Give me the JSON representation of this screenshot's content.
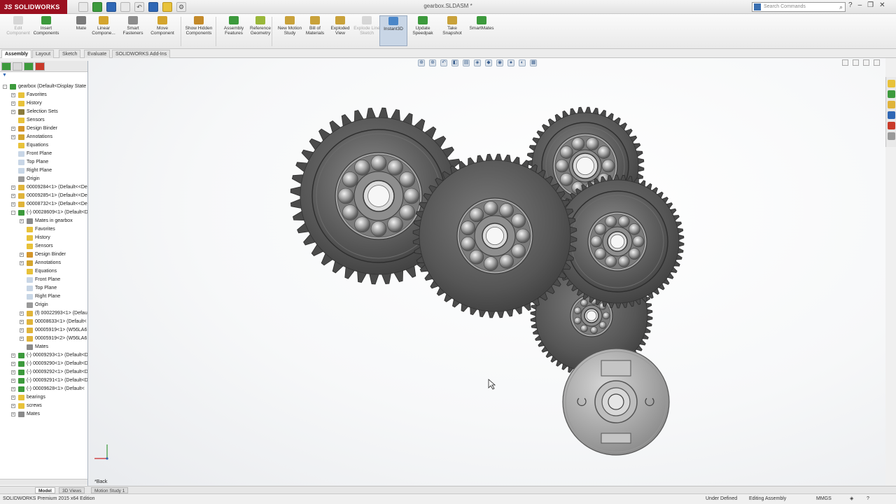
{
  "app": {
    "brand": "SOLIDWORKS",
    "brand_prefix": "3S",
    "document_title": "gearbox.SLDASM *",
    "search_placeholder": "Search Commands"
  },
  "command_manager": {
    "commands": [
      {
        "label": "Edit Component",
        "icon": "edit-component-icon",
        "color": "#9a9a9a",
        "disabled": true
      },
      {
        "label": "Insert Components",
        "icon": "insert-components-icon",
        "color": "#3c9a3c"
      },
      {
        "label": "Mate",
        "icon": "mate-icon",
        "color": "#7a7a7a"
      },
      {
        "label": "Linear Compone...",
        "icon": "linear-pattern-icon",
        "color": "#d4a52e"
      },
      {
        "label": "Smart Fasteners",
        "icon": "smart-fasteners-icon",
        "color": "#8c8c8c"
      },
      {
        "label": "Move Component",
        "icon": "move-component-icon",
        "color": "#d4a52e"
      },
      {
        "label": "Show Hidden Components",
        "icon": "show-hidden-icon",
        "color": "#c48a2a"
      },
      {
        "label": "Assembly Features",
        "icon": "assembly-features-icon",
        "color": "#3c9a3c"
      },
      {
        "label": "Reference Geometry",
        "icon": "reference-geometry-icon",
        "color": "#9ab83a"
      },
      {
        "label": "New Motion Study",
        "icon": "motion-study-icon",
        "color": "#c9a23a"
      },
      {
        "label": "Bill of Materials",
        "icon": "bom-icon",
        "color": "#c9a23a"
      },
      {
        "label": "Exploded View",
        "icon": "exploded-view-icon",
        "color": "#c9a23a"
      },
      {
        "label": "Explode Line Sketch",
        "icon": "explode-line-icon",
        "color": "#9a9a9a",
        "disabled": true
      },
      {
        "label": "Instant3D",
        "icon": "instant3d-icon",
        "color": "#4a86c8",
        "active": true
      },
      {
        "label": "Update Speedpak",
        "icon": "speedpak-icon",
        "color": "#3c9a3c"
      },
      {
        "label": "Take Snapshot",
        "icon": "snapshot-icon",
        "color": "#c9a23a"
      },
      {
        "label": "SmartMates",
        "icon": "smartmates-icon",
        "color": "#3c9a3c"
      }
    ]
  },
  "tabs": [
    "Assembly",
    "Layout",
    "Sketch",
    "Evaluate",
    "SOLIDWORKS Add-Ins"
  ],
  "active_tab": "Assembly",
  "feature_tree": {
    "filter_icon": "filter-icon",
    "items": [
      {
        "label": "gearbox  (Default<Display State",
        "indent": 0,
        "icon": "assembly",
        "toggle": "-"
      },
      {
        "label": "Favorites",
        "indent": 1,
        "icon": "folder",
        "toggle": "+"
      },
      {
        "label": "History",
        "indent": 1,
        "icon": "folder",
        "toggle": "+"
      },
      {
        "label": "Selection Sets",
        "indent": 1,
        "icon": "folder-dark",
        "toggle": "+"
      },
      {
        "label": "Sensors",
        "indent": 1,
        "icon": "folder",
        "toggle": ""
      },
      {
        "label": "Design Binder",
        "indent": 1,
        "icon": "binder",
        "toggle": "+"
      },
      {
        "label": "Annotations",
        "indent": 1,
        "icon": "annotation",
        "toggle": "+"
      },
      {
        "label": "Equations",
        "indent": 1,
        "icon": "folder",
        "toggle": ""
      },
      {
        "label": "Front Plane",
        "indent": 1,
        "icon": "plane",
        "toggle": ""
      },
      {
        "label": "Top Plane",
        "indent": 1,
        "icon": "plane",
        "toggle": ""
      },
      {
        "label": "Right Plane",
        "indent": 1,
        "icon": "plane",
        "toggle": ""
      },
      {
        "label": "Origin",
        "indent": 1,
        "icon": "origin",
        "toggle": ""
      },
      {
        "label": "00009284<1> (Default<<De",
        "indent": 1,
        "icon": "part",
        "toggle": "+"
      },
      {
        "label": "00009285<1> (Default<<De",
        "indent": 1,
        "icon": "part",
        "toggle": "+"
      },
      {
        "label": "00008732<1> (Default<<De",
        "indent": 1,
        "icon": "part",
        "toggle": "+"
      },
      {
        "label": "(-) 00028609<1> (Default<D",
        "indent": 1,
        "icon": "subassembly",
        "toggle": "-"
      },
      {
        "label": "Mates in gearbox",
        "indent": 2,
        "icon": "mates",
        "toggle": "+"
      },
      {
        "label": "Favorites",
        "indent": 2,
        "icon": "folder",
        "toggle": ""
      },
      {
        "label": "History",
        "indent": 2,
        "icon": "folder",
        "toggle": ""
      },
      {
        "label": "Sensors",
        "indent": 2,
        "icon": "folder",
        "toggle": ""
      },
      {
        "label": "Design Binder",
        "indent": 2,
        "icon": "binder",
        "toggle": "+"
      },
      {
        "label": "Annotations",
        "indent": 2,
        "icon": "annotation",
        "toggle": "+"
      },
      {
        "label": "Equations",
        "indent": 2,
        "icon": "folder",
        "toggle": ""
      },
      {
        "label": "Front Plane",
        "indent": 2,
        "icon": "plane",
        "toggle": ""
      },
      {
        "label": "Top Plane",
        "indent": 2,
        "icon": "plane",
        "toggle": ""
      },
      {
        "label": "Right Plane",
        "indent": 2,
        "icon": "plane",
        "toggle": ""
      },
      {
        "label": "Origin",
        "indent": 2,
        "icon": "origin",
        "toggle": ""
      },
      {
        "label": "(f) 00022993<1> (Defaul",
        "indent": 2,
        "icon": "part",
        "toggle": "+"
      },
      {
        "label": "00008633<1> (Default<",
        "indent": 2,
        "icon": "part",
        "toggle": "+"
      },
      {
        "label": "00005919<1> (W56LA6",
        "indent": 2,
        "icon": "part",
        "toggle": "+"
      },
      {
        "label": "00005919<2> (W56LA6",
        "indent": 2,
        "icon": "part",
        "toggle": "+"
      },
      {
        "label": "Mates",
        "indent": 2,
        "icon": "mates",
        "toggle": ""
      },
      {
        "label": "(-) 00009293<1> (Default<D",
        "indent": 1,
        "icon": "subassembly",
        "toggle": "+"
      },
      {
        "label": "(-) 00009290<1> (Default<D",
        "indent": 1,
        "icon": "subassembly",
        "toggle": "+"
      },
      {
        "label": "(-) 00009292<1> (Default<D",
        "indent": 1,
        "icon": "subassembly",
        "toggle": "+"
      },
      {
        "label": "(-) 00009291<1> (Default<D",
        "indent": 1,
        "icon": "subassembly",
        "toggle": "+"
      },
      {
        "label": "(-) 00009628<1> (Default<",
        "indent": 1,
        "icon": "subassembly",
        "toggle": "+"
      },
      {
        "label": "bearings",
        "indent": 1,
        "icon": "folder",
        "toggle": "+"
      },
      {
        "label": "screws",
        "indent": 1,
        "icon": "folder",
        "toggle": "+"
      },
      {
        "label": "Mates",
        "indent": 1,
        "icon": "mates",
        "toggle": "+"
      }
    ]
  },
  "viewport": {
    "view_label": "*Back"
  },
  "bottom_tabs": [
    "Model",
    "3D Views",
    "Motion Study 1"
  ],
  "active_bottom_tab": "Model",
  "status": {
    "edition": "SOLIDWORKS Premium 2015 x64 Edition",
    "definition": "Under Defined",
    "mode": "Editing Assembly",
    "units": "MMGS"
  },
  "colors": {
    "brand_red": "#9b1020",
    "active_blue": "#c9d6e6",
    "gear_gray": "#5e5e5e",
    "viewport_bg": "#f7f8f9"
  }
}
